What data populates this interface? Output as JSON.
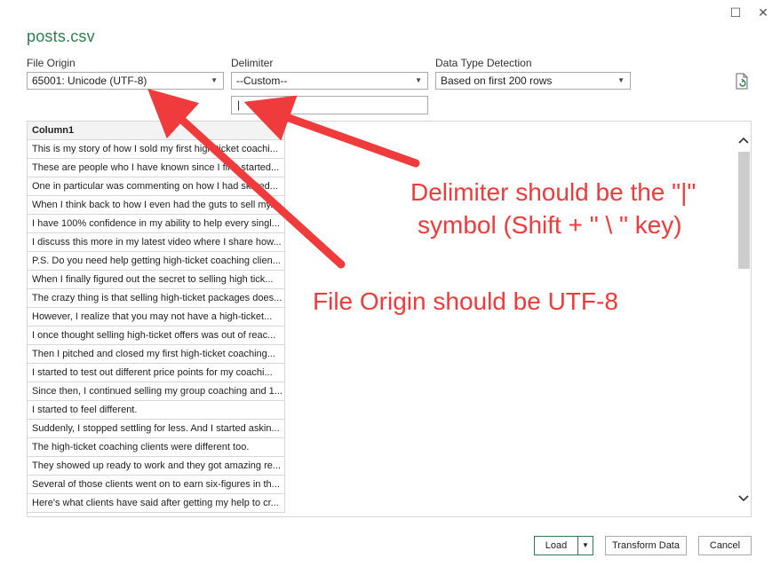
{
  "window": {
    "title": "posts.csv",
    "maximize_icon": "maximize-icon",
    "close_icon": "close-icon"
  },
  "settings": {
    "file_origin": {
      "label": "File Origin",
      "value": "65001: Unicode (UTF-8)"
    },
    "delimiter": {
      "label": "Delimiter",
      "value": "--Custom--",
      "custom_value": "|"
    },
    "data_type_detection": {
      "label": "Data Type Detection",
      "value": "Based on first 200 rows"
    },
    "refresh_icon": "refresh-icon"
  },
  "preview": {
    "column_header": "Column1",
    "rows": [
      "This is my story of how I sold my first high-ticket coachi...",
      "These are people who I have known since I first started...",
      "One in particular was commenting on how I had skirted...",
      "When I think back to how I even had the guts to sell my...",
      "I have 100% confidence in my ability to help every singl...",
      "I discuss this more in my latest video where I share how...",
      "P.S. Do you need help getting high-ticket coaching clien...",
      "When I finally figured out the secret to selling high tick...",
      "The crazy thing is that selling high-ticket packages does...",
      "However, I realize that you may not have a high-ticket...",
      "I once thought selling high-ticket offers was out of reac...",
      "Then I pitched and closed my first high-ticket coaching...",
      "I started to test out different price points for my coachi...",
      "Since then, I continued selling my group coaching and 1...",
      "I started to feel different.",
      "Suddenly, I stopped settling for less. And I started askin...",
      "The high-ticket coaching clients were different too.",
      "They showed up ready to work and they got amazing re...",
      "Several of those clients went on to earn six-figures in th...",
      "Here's what clients have said after getting my help to cr..."
    ]
  },
  "buttons": {
    "load": "Load",
    "transform": "Transform Data",
    "cancel": "Cancel"
  },
  "annotations": {
    "delimiter_line1": "Delimiter should be the \"|\"",
    "delimiter_line2": "symbol (Shift + \" \\ \"  key)",
    "file_origin": "File Origin should be UTF-8"
  },
  "colors": {
    "accent": "#2e7d4f",
    "annotation": "#ef3b3b"
  }
}
